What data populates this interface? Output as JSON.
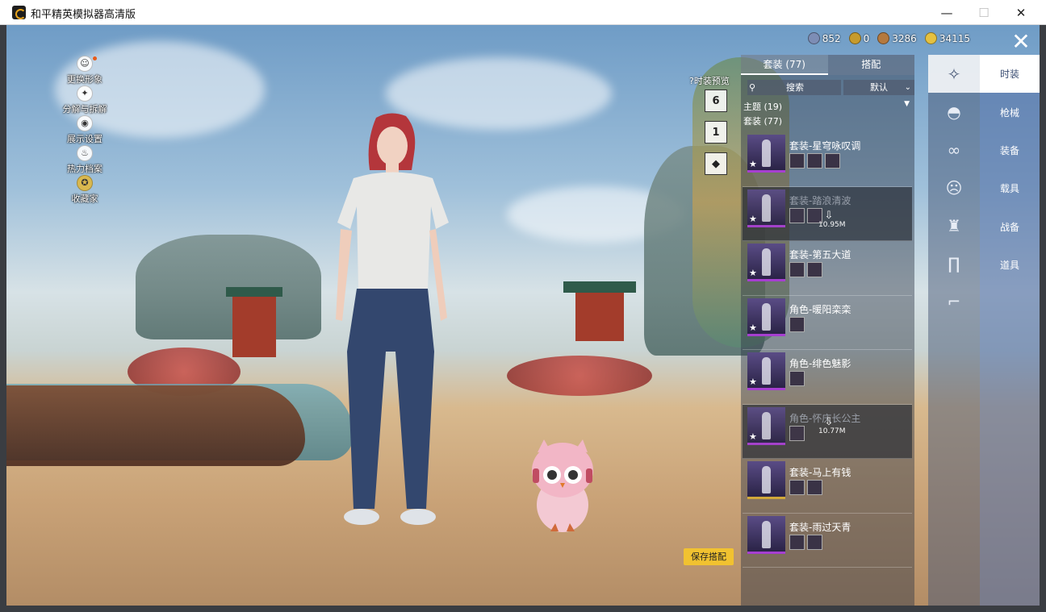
{
  "window": {
    "title": "和平精英模拟器高清版",
    "min": "—",
    "max": "☐",
    "close": "✕"
  },
  "currency": [
    {
      "icon": "coupon-icon",
      "value": "852",
      "color": "#7d8db5"
    },
    {
      "icon": "coin-icon",
      "value": "0",
      "color": "#c79b2c"
    },
    {
      "icon": "points-icon",
      "value": "3286",
      "color": "#b5793e"
    },
    {
      "icon": "gold-icon",
      "value": "34115",
      "color": "#e5c140"
    }
  ],
  "close_button": "✕",
  "left_menu": [
    {
      "label": "更换形象",
      "icon": "avatar-icon",
      "glyph": "☺"
    },
    {
      "label": "分解与拆解",
      "icon": "dismantle-icon",
      "glyph": "✦"
    },
    {
      "label": "展示设置",
      "icon": "eye-icon",
      "glyph": "◉"
    },
    {
      "label": "热力档案",
      "icon": "flame-icon",
      "glyph": "♨"
    },
    {
      "label": "收藏家",
      "icon": "collector-icon",
      "glyph": "✪"
    }
  ],
  "preview_label": "?时装预览",
  "side_tools": [
    "6",
    "1",
    "◆"
  ],
  "panel": {
    "tab_active": "套装 (77)",
    "tab_inactive": "搭配",
    "search_icon": "⚲",
    "search_placeholder": "搜索",
    "sort_label": "默认",
    "sort_chevron": "⌄",
    "section_theme": "主题 (19)",
    "section_theme_arrow": "▼",
    "section_suits": "套装 (77)"
  },
  "items": [
    {
      "title": "套装-星穹咏叹调",
      "dim": false,
      "subs": 3,
      "rarity": "purple",
      "download": ""
    },
    {
      "title": "套装-踏浪清波",
      "dim": true,
      "subs": 2,
      "rarity": "purple",
      "download": "10.95M"
    },
    {
      "title": "套装-第五大道",
      "dim": false,
      "subs": 2,
      "rarity": "purple",
      "download": ""
    },
    {
      "title": "角色-暖阳栾栾",
      "dim": false,
      "subs": 1,
      "rarity": "purple",
      "download": ""
    },
    {
      "title": "角色-绯色魅影",
      "dim": false,
      "subs": 1,
      "rarity": "purple",
      "download": ""
    },
    {
      "title": "角色-怀庆长公主",
      "dim": true,
      "subs": 1,
      "rarity": "purple",
      "download": "10.77M"
    },
    {
      "title": "套装-马上有钱",
      "dim": false,
      "subs": 2,
      "rarity": "gold",
      "download": ""
    },
    {
      "title": "套装-雨过天青",
      "dim": false,
      "subs": 2,
      "rarity": "purple",
      "download": ""
    }
  ],
  "categories": [
    {
      "label": "时装",
      "icon": "outfit-icon",
      "glyph": "✧",
      "active": true
    },
    {
      "label": "枪械",
      "icon": "cap-icon",
      "glyph": "◓",
      "active": false
    },
    {
      "label": "装备",
      "icon": "goggles-icon",
      "glyph": "∞",
      "active": false
    },
    {
      "label": "载具",
      "icon": "face-icon",
      "glyph": "☹",
      "active": false
    },
    {
      "label": "战备",
      "icon": "jacket-icon",
      "glyph": "♜",
      "active": false
    },
    {
      "label": "道具",
      "icon": "pants-icon",
      "glyph": "∏",
      "active": false
    },
    {
      "label": "",
      "icon": "shoes-icon",
      "glyph": "⌐",
      "active": false
    }
  ],
  "save_button": "保存搭配"
}
